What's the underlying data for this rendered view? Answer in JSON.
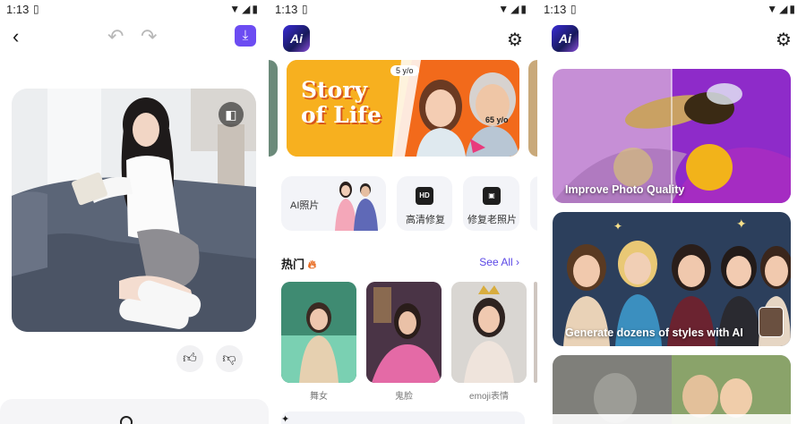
{
  "status_bar": {
    "time": "1:13",
    "sim_icon": "sim-card-icon",
    "icons": "wifi signal battery"
  },
  "editor": {
    "back_icon": "chevron-left-icon",
    "undo_icon": "undo-icon",
    "redo_icon": "redo-icon",
    "download_icon": "download-icon",
    "compare_icon": "compare-icon",
    "thumbs_up_icon": "thumbs-up-icon",
    "thumbs_down_icon": "thumbs-down-icon"
  },
  "home": {
    "settings_icon": "gear-icon",
    "banner": {
      "title_line1": "Story",
      "title_line2": "of Life",
      "age_young": "5 y/o",
      "age_old": "65 y/o"
    },
    "features": [
      {
        "label": "AI照片"
      },
      {
        "label": "高清修复",
        "badge": "HD"
      },
      {
        "label": "修复老照片"
      }
    ],
    "section": {
      "title": "热门",
      "see_all": "See All"
    },
    "cards": [
      {
        "label": "舞女"
      },
      {
        "label": "鬼脸"
      },
      {
        "label": "emoji表情"
      }
    ]
  },
  "features_page": {
    "settings_icon": "gear-icon",
    "cards": [
      {
        "label": "Improve Photo Quality"
      },
      {
        "label": "Generate dozens of styles with AI"
      }
    ]
  },
  "colors": {
    "accent": "#6c4cf2",
    "link": "#5b47e6",
    "banner": "#f7b01f"
  }
}
